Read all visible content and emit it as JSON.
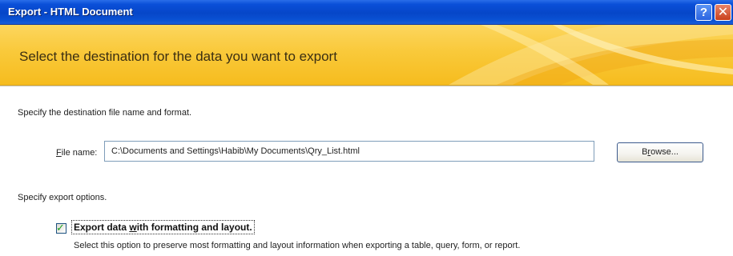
{
  "window": {
    "title": "Export - HTML Document",
    "help_button": "?",
    "close_button": "✕",
    "colors": {
      "titlebar": "#0a4fd8",
      "banner": "#f9c93a",
      "close": "#c9401c"
    }
  },
  "banner": {
    "heading": "Select the destination for the data you want to export"
  },
  "content": {
    "destination_prompt": "Specify the destination file name and format.",
    "file_name": {
      "label_prefix": "F",
      "label_rest": "ile name:",
      "value": "C:\\Documents and Settings\\Habib\\My Documents\\Qry_List.html"
    },
    "browse_button": {
      "label_prefix": "B",
      "label_underlined": "r",
      "label_rest": "owse..."
    },
    "options_prompt": "Specify export options.",
    "export_option": {
      "checked": true,
      "label_before": "Export data ",
      "label_underlined": "w",
      "label_after": "ith formatting and layout.",
      "description": "Select this option to preserve most formatting and layout information when exporting a table, query, form, or report."
    }
  }
}
